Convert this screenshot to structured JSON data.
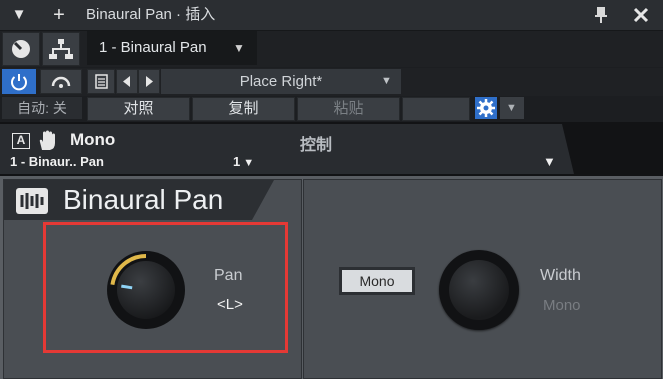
{
  "window": {
    "title": "Binaural Pan · 插入",
    "menu_icon": "triangle-down-icon",
    "add_icon": "plus-icon",
    "pin_icon": "pin-icon",
    "close_icon": "close-icon"
  },
  "toolbar": {
    "preset_slot": "1 - Binaural Pan",
    "preset_name": "Place Right*",
    "auto_label": "自动: 关",
    "compare_label": "对照",
    "copy_label": "复制",
    "paste_label": "粘贴"
  },
  "channel": {
    "mode_label": "Mono",
    "name": "1 - Binaur.. Pan",
    "control_label": "控制",
    "channel_num": "1"
  },
  "plugin": {
    "name": "Binaural Pan",
    "pan_label": "Pan",
    "pan_value": "<L>",
    "pan_position": -0.6,
    "mono_button": "Mono",
    "width_label": "Width",
    "width_value": "Mono"
  },
  "colors": {
    "accent_blue": "#2f6fc9",
    "gold_arc": "#e0b84a",
    "highlight_red": "#e53935"
  }
}
